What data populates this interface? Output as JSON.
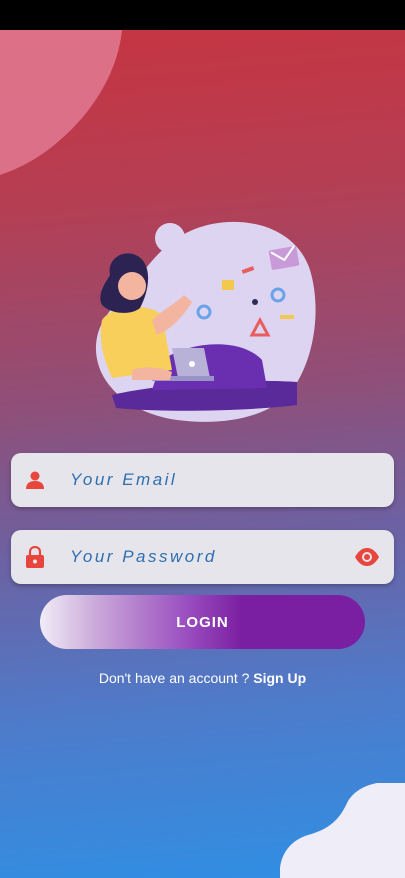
{
  "form": {
    "email_placeholder": "Your Email",
    "password_placeholder": "Your Password"
  },
  "actions": {
    "login_label": "LOGIN"
  },
  "signup": {
    "prompt": "Don't have an account ?",
    "link_label": "Sign Up"
  },
  "icons": {
    "email": "person-icon",
    "password": "lock-icon",
    "visibility": "eye-icon"
  },
  "colors": {
    "icon_red": "#e8453c",
    "input_text": "#2f6fb0",
    "button_purple": "#7b1fa2",
    "field_bg": "#e6e5ec"
  }
}
